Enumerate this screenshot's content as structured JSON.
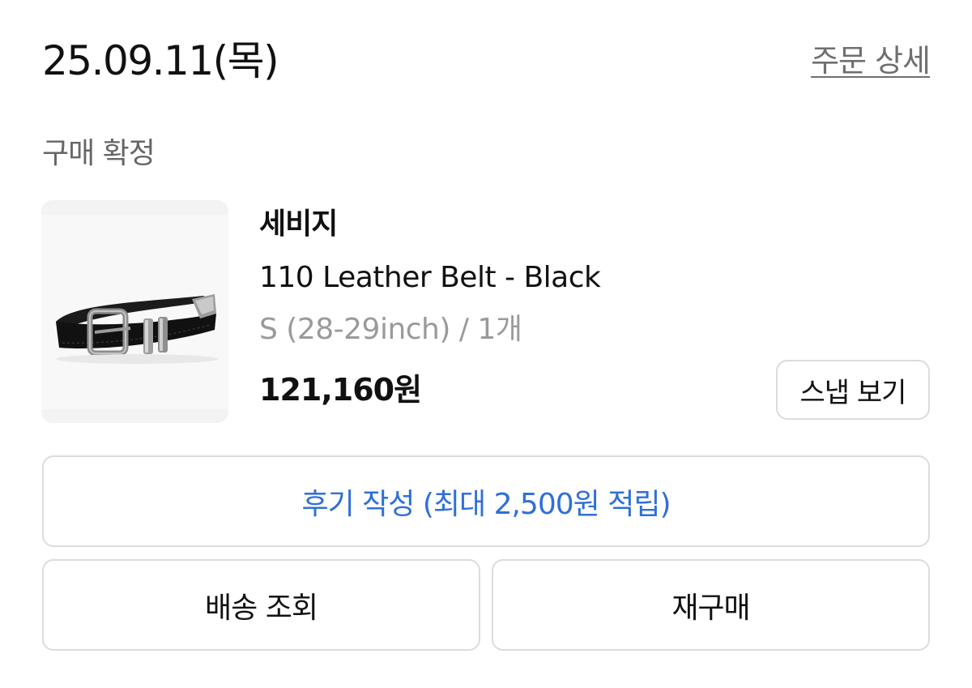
{
  "order": {
    "date": "25.09.11(목)",
    "detail_link": "주문 상세",
    "status": "구매 확정"
  },
  "product": {
    "brand": "세비지",
    "name": "110 Leather Belt - Black",
    "option": "S (28-29inch) / 1개",
    "price": "121,160원",
    "image": "black-leather-belt-with-silver-buckle"
  },
  "actions": {
    "snap_label": "스냅 보기",
    "review_label": "후기 작성 (최대 2,500원 적립)",
    "tracking_label": "배송 조회",
    "repurchase_label": "재구매"
  },
  "colors": {
    "text_primary": "#111111",
    "text_secondary": "#666666",
    "text_muted": "#9a9a9a",
    "link": "#6f6f6f",
    "accent_blue": "#2f6fd9",
    "border": "#dcdcdc"
  }
}
